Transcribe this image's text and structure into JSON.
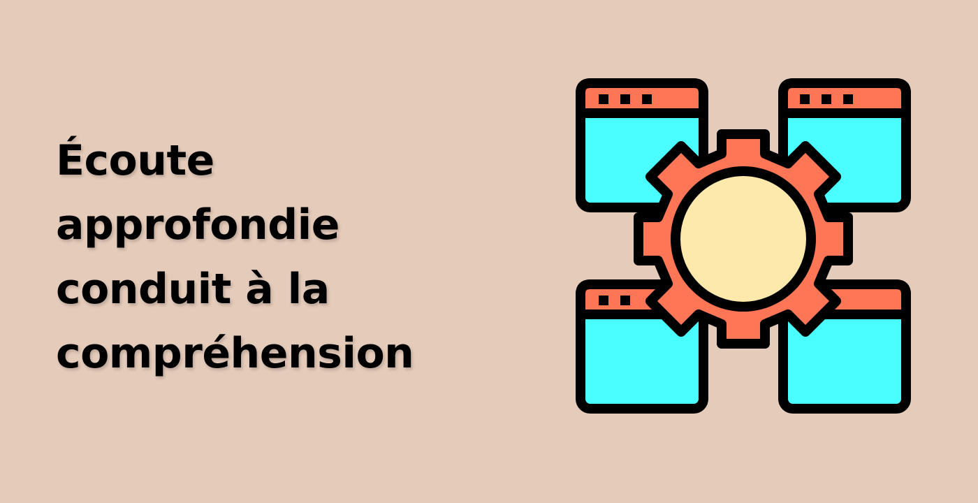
{
  "headline": {
    "lines": [
      "Écoute",
      "approfondie",
      "conduit à la",
      "compréhension"
    ]
  },
  "illustration": {
    "icon": "gear-with-windows-icon",
    "colors": {
      "background": "#e5cbba",
      "outline": "#000000",
      "window_header": "#ff7656",
      "window_body": "#4afeff",
      "gear": "#ff7656",
      "gear_center": "#fde9ab"
    }
  }
}
